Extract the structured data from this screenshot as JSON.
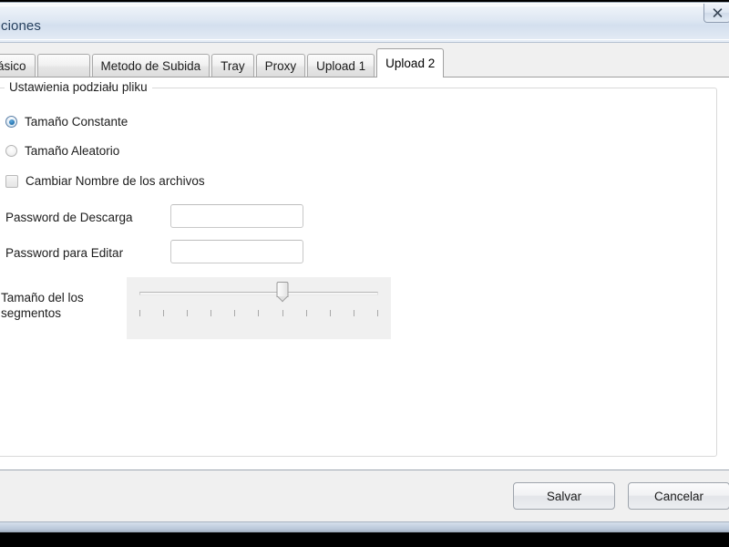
{
  "window": {
    "title": "ciones",
    "close_label": "✕",
    "close_icon": "close-icon"
  },
  "tabs": [
    {
      "label": "ásico",
      "active": false,
      "blank": false
    },
    {
      "label": "",
      "active": false,
      "blank": true
    },
    {
      "label": "Metodo de Subida",
      "active": false,
      "blank": false
    },
    {
      "label": "Tray",
      "active": false,
      "blank": false
    },
    {
      "label": "Proxy",
      "active": false,
      "blank": false
    },
    {
      "label": "Upload 1",
      "active": false,
      "blank": false
    },
    {
      "label": "Upload 2",
      "active": true,
      "blank": false
    }
  ],
  "panel": {
    "groupbox_title": "Ustawienia podziału pliku",
    "radio_group": {
      "selected_index": 0,
      "options": [
        {
          "label": "Tamaño Constante",
          "checked": true
        },
        {
          "label": "Tamaño Aleatorio",
          "checked": false
        }
      ]
    },
    "checkbox": {
      "label": "Cambiar Nombre de los archivos",
      "checked": false
    },
    "fields": [
      {
        "label": "Password de Descarga",
        "value": "",
        "placeholder": ""
      },
      {
        "label": "Password para Editar",
        "value": "",
        "placeholder": ""
      }
    ],
    "slider": {
      "label_line1": "Tamaño del los",
      "label_line2": "segmentos",
      "tick_count": 11,
      "value_index": 6,
      "min_index": 0,
      "max_index": 10
    }
  },
  "footer": {
    "save_label": "Salvar",
    "cancel_label": "Cancelar"
  },
  "colors": {
    "accent": "#2272ad",
    "titlebar": "#ccd9e9",
    "panel_bg": "#ffffff",
    "dialog_bg": "#f0f0f0"
  }
}
